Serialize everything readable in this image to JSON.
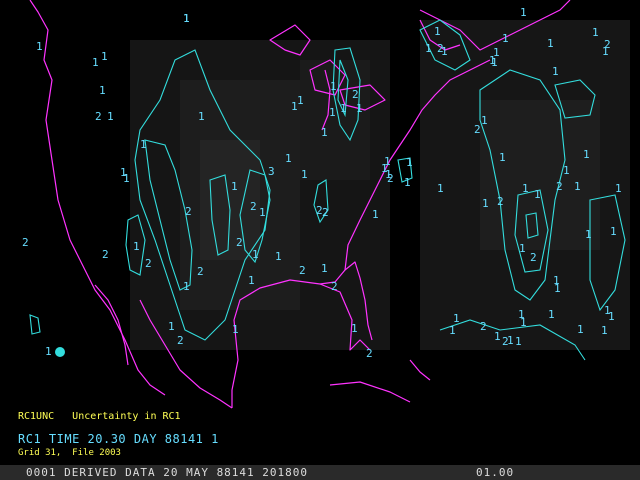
{
  "colors": {
    "background": "#000000",
    "coastline": "#ff33ff",
    "contour": "#33dddd",
    "label": "#66ddff",
    "caption_yellow": "#ffff55",
    "caption_cyan": "#66ddff",
    "status_bar": "#2a2a2a"
  },
  "caption": {
    "variable_line": "RC1UNC   Uncertainty in RC1",
    "time_line": "RC1 TIME 20.30 DAY 88141 1",
    "grid_line": "Grid 31,  File 2003"
  },
  "status_bar": {
    "left": "0001 DERIVED DATA 20 MAY 88141 201800",
    "right": "01.00"
  },
  "map": {
    "contour_labels": [
      "1",
      "1",
      "1",
      "1",
      "1",
      "2",
      "1",
      "1",
      "1",
      "1",
      "1",
      "2",
      "1",
      "2",
      "2",
      "1",
      "2",
      "1",
      "2",
      "1",
      "1",
      "2",
      "1",
      "1",
      "2",
      "1",
      "1",
      "2",
      "1",
      "2",
      "1",
      "1",
      "1",
      "1",
      "1",
      "2",
      "1",
      "1",
      "1",
      "1",
      "3",
      "2",
      "2",
      "1",
      "1",
      "2",
      "1",
      "1",
      "1",
      "1",
      "1",
      "2",
      "1",
      "1",
      "1",
      "2",
      "1",
      "2",
      "1",
      "1",
      "1",
      "1",
      "1",
      "1",
      "1",
      "1",
      "1",
      "1",
      "1",
      "1",
      "1",
      "1",
      "1",
      "2",
      "1",
      "2",
      "1",
      "1",
      "2",
      "1",
      "1",
      "2",
      "1",
      "1",
      "2",
      "1",
      "1",
      "1",
      "1",
      "1",
      "1",
      "1",
      "1",
      "2",
      "1",
      "1",
      "1",
      "2",
      "1",
      "1",
      "1",
      "1"
    ]
  }
}
